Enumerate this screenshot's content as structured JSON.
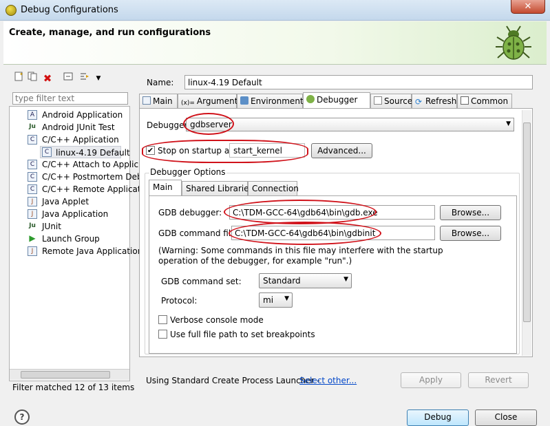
{
  "window": {
    "title": "Debug Configurations",
    "close_glyph": "✕",
    "banner_title": "Create, manage, and run configurations"
  },
  "left": {
    "filter_placeholder": "type filter text",
    "tree": [
      {
        "label": "Android Application",
        "icon": "android-app-icon",
        "glyph": "A"
      },
      {
        "label": "Android JUnit Test",
        "icon": "junit-icon",
        "glyph": "Ju"
      },
      {
        "label": "C/C++ Application",
        "icon": "c-app-icon",
        "glyph": "C"
      },
      {
        "label": "linux-4.19 Default",
        "icon": "c-config-icon",
        "glyph": "C"
      },
      {
        "label": "C/C++ Attach to Applic",
        "icon": "c-app-icon",
        "glyph": "C"
      },
      {
        "label": "C/C++ Postmortem Deb",
        "icon": "c-app-icon",
        "glyph": "C"
      },
      {
        "label": "C/C++ Remote Applicat",
        "icon": "c-app-icon",
        "glyph": "C"
      },
      {
        "label": "Java Applet",
        "icon": "java-applet-icon",
        "glyph": "J"
      },
      {
        "label": "Java Application",
        "icon": "java-app-icon",
        "glyph": "J"
      },
      {
        "label": "JUnit",
        "icon": "junit-icon",
        "glyph": "Ju"
      },
      {
        "label": "Launch Group",
        "icon": "launch-group-icon",
        "glyph": "▶"
      },
      {
        "label": "Remote Java Application",
        "icon": "remote-java-icon",
        "glyph": "J"
      }
    ],
    "filter_status": "Filter matched 12 of 13 items"
  },
  "right": {
    "name_label": "Name:",
    "name_value": "linux-4.19 Default",
    "tabs": [
      "Main",
      "Arguments",
      "Environment",
      "Debugger",
      "Source",
      "Refresh",
      "Common"
    ],
    "active_tab": "Debugger",
    "debugger_label": "Debugger:",
    "debugger_value": "gdbserver",
    "stop_on_startup_label": "Stop on startup at:",
    "stop_on_startup_checked": true,
    "stop_on_startup_value": "start_kernel",
    "advanced_button": "Advanced...",
    "debugger_options_label": "Debugger Options",
    "inner_tabs": [
      "Main",
      "Shared Libraries",
      "Connection"
    ],
    "gdb_debugger_label": "GDB debugger:",
    "gdb_debugger_value": "C:\\TDM-GCC-64\\gdb64\\bin\\gdb.exe",
    "gdb_command_file_label": "GDB command file:",
    "gdb_command_file_value": "C:\\TDM-GCC-64\\gdb64\\bin\\gdbinit",
    "browse_button": "Browse...",
    "warning_text": "(Warning: Some commands in this file may interfere with the startup operation of the debugger, for example \"run\".)",
    "gdb_command_set_label": "GDB command set:",
    "gdb_command_set_value": "Standard",
    "protocol_label": "Protocol:",
    "protocol_value": "mi",
    "verbose_label": "Verbose console mode",
    "full_path_label": "Use full file path to set breakpoints",
    "launcher_text": "Using Standard Create Process Launcher -",
    "select_other_link": "Select other...",
    "apply_button": "Apply",
    "revert_button": "Revert"
  },
  "footer": {
    "help_glyph": "?",
    "debug_button": "Debug",
    "close_button": "Close"
  },
  "colors": {
    "annotation_red": "#d0121a",
    "link_blue": "#0046c8",
    "banner_green": "#dbeecd"
  }
}
